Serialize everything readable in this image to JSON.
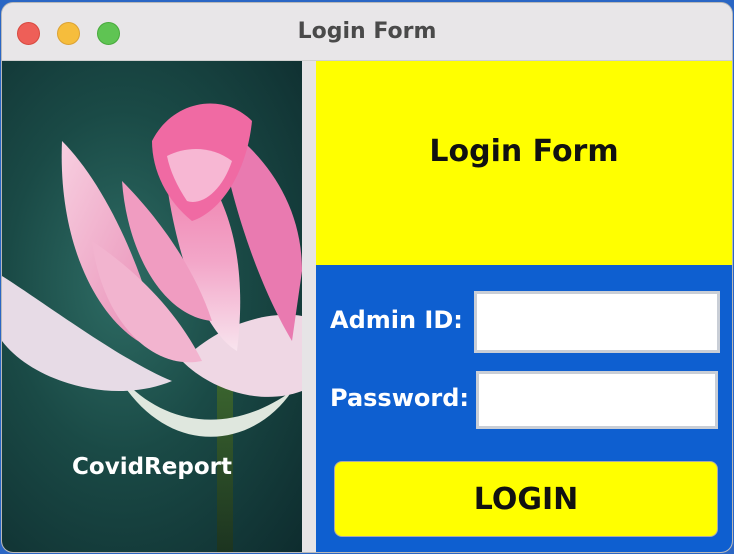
{
  "window": {
    "title": "Login Form"
  },
  "left_panel": {
    "caption": "CovidReport",
    "image": "pink-lotus-flower"
  },
  "form": {
    "header": "Login Form",
    "admin_label": "Admin ID:",
    "admin_value": "",
    "password_label": "Password:",
    "password_value": "",
    "login_label": "LOGIN"
  },
  "colors": {
    "header_bg": "#ffff00",
    "form_bg": "#0e5fd0",
    "button_bg": "#ffff00"
  }
}
